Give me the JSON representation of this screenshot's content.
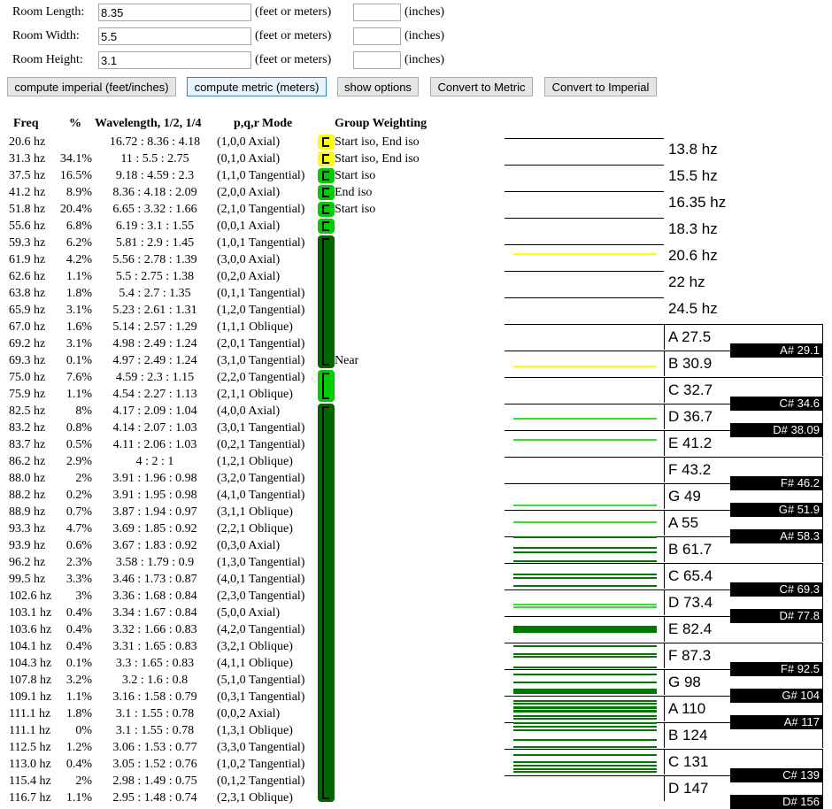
{
  "form": {
    "rows": [
      {
        "label": "Room Length:",
        "value": "8.35",
        "unit": "(feet or meters)",
        "inches_unit": "(inches)"
      },
      {
        "label": "Room Width:",
        "value": "5.5",
        "unit": "(feet or meters)",
        "inches_unit": "(inches)"
      },
      {
        "label": "Room Height:",
        "value": "3.1",
        "unit": "(feet or meters)",
        "inches_unit": "(inches)"
      }
    ],
    "buttons": {
      "imperial": "compute imperial (feet/inches)",
      "metric": "compute metric (meters)",
      "options": "show options",
      "to_metric": "Convert to Metric",
      "to_imperial": "Convert to Imperial"
    }
  },
  "table": {
    "headers": {
      "freq": "Freq",
      "pct": "%",
      "wave": "Wavelength, 1/2, 1/4",
      "mode": "p,q,r Mode",
      "group": "Group Weighting"
    },
    "rows": [
      {
        "freq": "20.6 hz",
        "pct": "",
        "wave": "16.72 : 8.36 : 4.18",
        "mode": "(1,0,0 Axial)",
        "note": "Start iso, End iso"
      },
      {
        "freq": "31.3 hz",
        "pct": "34.1%",
        "wave": "11 : 5.5 : 2.75",
        "mode": "(0,1,0 Axial)",
        "note": "Start iso, End iso"
      },
      {
        "freq": "37.5 hz",
        "pct": "16.5%",
        "wave": "9.18 : 4.59 : 2.3",
        "mode": "(1,1,0 Tangential)",
        "note": "Start iso"
      },
      {
        "freq": "41.2 hz",
        "pct": "8.9%",
        "wave": "8.36 : 4.18 : 2.09",
        "mode": "(2,0,0 Axial)",
        "note": "End iso"
      },
      {
        "freq": "51.8 hz",
        "pct": "20.4%",
        "wave": "6.65 : 3.32 : 1.66",
        "mode": "(2,1,0 Tangential)",
        "note": "Start iso"
      },
      {
        "freq": "55.6 hz",
        "pct": "6.8%",
        "wave": "6.19 : 3.1 : 1.55",
        "mode": "(0,0,1 Axial)",
        "note": ""
      },
      {
        "freq": "59.3 hz",
        "pct": "6.2%",
        "wave": "5.81 : 2.9 : 1.45",
        "mode": "(1,0,1 Tangential)",
        "note": ""
      },
      {
        "freq": "61.9 hz",
        "pct": "4.2%",
        "wave": "5.56 : 2.78 : 1.39",
        "mode": "(3,0,0 Axial)",
        "note": ""
      },
      {
        "freq": "62.6 hz",
        "pct": "1.1%",
        "wave": "5.5 : 2.75 : 1.38",
        "mode": "(0,2,0 Axial)",
        "note": ""
      },
      {
        "freq": "63.8 hz",
        "pct": "1.8%",
        "wave": "5.4 : 2.7 : 1.35",
        "mode": "(0,1,1 Tangential)",
        "note": ""
      },
      {
        "freq": "65.9 hz",
        "pct": "3.1%",
        "wave": "5.23 : 2.61 : 1.31",
        "mode": "(1,2,0 Tangential)",
        "note": ""
      },
      {
        "freq": "67.0 hz",
        "pct": "1.6%",
        "wave": "5.14 : 2.57 : 1.29",
        "mode": "(1,1,1 Oblique)",
        "note": ""
      },
      {
        "freq": "69.2 hz",
        "pct": "3.1%",
        "wave": "4.98 : 2.49 : 1.24",
        "mode": "(2,0,1 Tangential)",
        "note": ""
      },
      {
        "freq": "69.3 hz",
        "pct": "0.1%",
        "wave": "4.97 : 2.49 : 1.24",
        "mode": "(3,1,0 Tangential)",
        "note": "Near"
      },
      {
        "freq": "75.0 hz",
        "pct": "7.6%",
        "wave": "4.59 : 2.3 : 1.15",
        "mode": "(2,2,0 Tangential)",
        "note": ""
      },
      {
        "freq": "75.9 hz",
        "pct": "1.1%",
        "wave": "4.54 : 2.27 : 1.13",
        "mode": "(2,1,1 Oblique)",
        "note": ""
      },
      {
        "freq": "82.5 hz",
        "pct": "8%",
        "wave": "4.17 : 2.09 : 1.04",
        "mode": "(4,0,0 Axial)",
        "note": ""
      },
      {
        "freq": "83.2 hz",
        "pct": "0.8%",
        "wave": "4.14 : 2.07 : 1.03",
        "mode": "(3,0,1 Tangential)",
        "note": ""
      },
      {
        "freq": "83.7 hz",
        "pct": "0.5%",
        "wave": "4.11 : 2.06 : 1.03",
        "mode": "(0,2,1 Tangential)",
        "note": ""
      },
      {
        "freq": "86.2 hz",
        "pct": "2.9%",
        "wave": "4 : 2 : 1",
        "mode": "(1,2,1 Oblique)",
        "note": ""
      },
      {
        "freq": "88.0 hz",
        "pct": "2%",
        "wave": "3.91 : 1.96 : 0.98",
        "mode": "(3,2,0 Tangential)",
        "note": ""
      },
      {
        "freq": "88.2 hz",
        "pct": "0.2%",
        "wave": "3.91 : 1.95 : 0.98",
        "mode": "(4,1,0 Tangential)",
        "note": ""
      },
      {
        "freq": "88.9 hz",
        "pct": "0.7%",
        "wave": "3.87 : 1.94 : 0.97",
        "mode": "(3,1,1 Oblique)",
        "note": ""
      },
      {
        "freq": "93.3 hz",
        "pct": "4.7%",
        "wave": "3.69 : 1.85 : 0.92",
        "mode": "(2,2,1 Oblique)",
        "note": ""
      },
      {
        "freq": "93.9 hz",
        "pct": "0.6%",
        "wave": "3.67 : 1.83 : 0.92",
        "mode": "(0,3,0 Axial)",
        "note": ""
      },
      {
        "freq": "96.2 hz",
        "pct": "2.3%",
        "wave": "3.58 : 1.79 : 0.9",
        "mode": "(1,3,0 Tangential)",
        "note": ""
      },
      {
        "freq": "99.5 hz",
        "pct": "3.3%",
        "wave": "3.46 : 1.73 : 0.87",
        "mode": "(4,0,1 Tangential)",
        "note": ""
      },
      {
        "freq": "102.6 hz",
        "pct": "3%",
        "wave": "3.36 : 1.68 : 0.84",
        "mode": "(2,3,0 Tangential)",
        "note": ""
      },
      {
        "freq": "103.1 hz",
        "pct": "0.4%",
        "wave": "3.34 : 1.67 : 0.84",
        "mode": "(5,0,0 Axial)",
        "note": ""
      },
      {
        "freq": "103.6 hz",
        "pct": "0.4%",
        "wave": "3.32 : 1.66 : 0.83",
        "mode": "(4,2,0 Tangential)",
        "note": ""
      },
      {
        "freq": "104.1 hz",
        "pct": "0.4%",
        "wave": "3.31 : 1.65 : 0.83",
        "mode": "(3,2,1 Oblique)",
        "note": ""
      },
      {
        "freq": "104.3 hz",
        "pct": "0.1%",
        "wave": "3.3 : 1.65 : 0.83",
        "mode": "(4,1,1 Oblique)",
        "note": ""
      },
      {
        "freq": "107.8 hz",
        "pct": "3.2%",
        "wave": "3.2 : 1.6 : 0.8",
        "mode": "(5,1,0 Tangential)",
        "note": ""
      },
      {
        "freq": "109.1 hz",
        "pct": "1.1%",
        "wave": "3.16 : 1.58 : 0.79",
        "mode": "(0,3,1 Tangential)",
        "note": ""
      },
      {
        "freq": "111.1 hz",
        "pct": "1.8%",
        "wave": "3.1 : 1.55 : 0.78",
        "mode": "(0,0,2 Axial)",
        "note": ""
      },
      {
        "freq": "111.1 hz",
        "pct": "0%",
        "wave": "3.1 : 1.55 : 0.78",
        "mode": "(1,3,1 Oblique)",
        "note": ""
      },
      {
        "freq": "112.5 hz",
        "pct": "1.2%",
        "wave": "3.06 : 1.53 : 0.77",
        "mode": "(3,3,0 Tangential)",
        "note": ""
      },
      {
        "freq": "113.0 hz",
        "pct": "0.4%",
        "wave": "3.05 : 1.52 : 0.76",
        "mode": "(1,0,2 Tangential)",
        "note": ""
      },
      {
        "freq": "115.4 hz",
        "pct": "2%",
        "wave": "2.98 : 1.49 : 0.75",
        "mode": "(0,1,2 Tangential)",
        "note": ""
      },
      {
        "freq": "116.7 hz",
        "pct": "1.1%",
        "wave": "2.95 : 1.48 : 0.74",
        "mode": "(2,3,1 Oblique)",
        "note": ""
      }
    ],
    "groups": [
      {
        "rows": [
          0,
          0
        ],
        "color": "#ffff00"
      },
      {
        "rows": [
          1,
          1
        ],
        "color": "#ffff00"
      },
      {
        "rows": [
          2,
          2
        ],
        "color": "#00cc00"
      },
      {
        "rows": [
          3,
          3
        ],
        "color": "#00cc00"
      },
      {
        "rows": [
          4,
          4
        ],
        "color": "#00cc00"
      },
      {
        "rows": [
          5,
          5
        ],
        "color": "#00cc00"
      },
      {
        "rows": [
          6,
          13
        ],
        "color": "#006600"
      },
      {
        "rows": [
          14,
          15
        ],
        "color": "#00cc00"
      },
      {
        "rows": [
          16,
          39
        ],
        "color": "#006600"
      }
    ]
  },
  "keyboard": {
    "top_freq_labels": [
      "13.8 hz",
      "15.5 hz",
      "16.35 hz",
      "18.3 hz",
      "20.6 hz",
      "22 hz",
      "24.5 hz"
    ],
    "white_keys": [
      "A 27.5",
      "B 30.9",
      "C 32.7",
      "D 36.7",
      "E 41.2",
      "F 43.2",
      "G 49",
      "A 55",
      "B 61.7",
      "C 65.4",
      "D 73.4",
      "E 82.4",
      "F 87.3",
      "G 98",
      "A 110",
      "B 124",
      "C 131",
      "D 147"
    ],
    "black_keys": [
      {
        "label": "A# 29.1",
        "after": 0
      },
      {
        "label": "C# 34.6",
        "after": 2
      },
      {
        "label": "D# 38.09",
        "after": 3
      },
      {
        "label": "F# 46.2",
        "after": 5
      },
      {
        "label": "G# 51.9",
        "after": 6
      },
      {
        "label": "A# 58.3",
        "after": 7
      },
      {
        "label": "C# 69.3",
        "after": 9
      },
      {
        "label": "D# 77.8",
        "after": 10
      },
      {
        "label": "F# 92.5",
        "after": 12
      },
      {
        "label": "G# 104",
        "after": 13
      },
      {
        "label": "A# 117",
        "after": 14
      },
      {
        "label": "C# 139",
        "after": 16
      },
      {
        "label": "D# 156",
        "after": 17
      }
    ],
    "mode_lines": [
      {
        "freq": 20.6,
        "color": "#ffff00",
        "weight": 2
      },
      {
        "freq": 31.3,
        "color": "#ffff00",
        "weight": 2
      },
      {
        "freq": 37.5,
        "color": "#33dd33",
        "weight": 2
      },
      {
        "freq": 41.2,
        "color": "#33dd33",
        "weight": 2
      },
      {
        "freq": 51.8,
        "color": "#33dd33",
        "weight": 2
      },
      {
        "freq": 55.6,
        "color": "#33dd33",
        "weight": 2
      },
      {
        "freq": 59.3,
        "color": "#007700",
        "weight": 2
      },
      {
        "freq": 61.9,
        "color": "#007700",
        "weight": 2
      },
      {
        "freq": 62.6,
        "color": "#007700",
        "weight": 2
      },
      {
        "freq": 63.8,
        "color": "#007700",
        "weight": 2
      },
      {
        "freq": 65.9,
        "color": "#007700",
        "weight": 2
      },
      {
        "freq": 67.0,
        "color": "#007700",
        "weight": 2
      },
      {
        "freq": 69.2,
        "color": "#007700",
        "weight": 2
      },
      {
        "freq": 69.3,
        "color": "#007700",
        "weight": 2
      },
      {
        "freq": 75.0,
        "color": "#33dd33",
        "weight": 2
      },
      {
        "freq": 75.9,
        "color": "#33dd33",
        "weight": 2
      },
      {
        "freq": 82.5,
        "color": "#007700",
        "weight": 5
      },
      {
        "freq": 83.2,
        "color": "#007700",
        "weight": 4
      },
      {
        "freq": 86.2,
        "color": "#007700",
        "weight": 2
      },
      {
        "freq": 88.0,
        "color": "#007700",
        "weight": 2
      },
      {
        "freq": 88.9,
        "color": "#007700",
        "weight": 2
      },
      {
        "freq": 93.3,
        "color": "#007700",
        "weight": 2
      },
      {
        "freq": 96.2,
        "color": "#007700",
        "weight": 2
      },
      {
        "freq": 99.5,
        "color": "#007700",
        "weight": 2
      },
      {
        "freq": 102.6,
        "color": "#007700",
        "weight": 2
      },
      {
        "freq": 103.1,
        "color": "#007700",
        "weight": 2
      },
      {
        "freq": 103.6,
        "color": "#007700",
        "weight": 2
      },
      {
        "freq": 104.1,
        "color": "#007700",
        "weight": 2
      },
      {
        "freq": 107.8,
        "color": "#007700",
        "weight": 2
      },
      {
        "freq": 109.1,
        "color": "#007700",
        "weight": 2
      },
      {
        "freq": 111.1,
        "color": "#007700",
        "weight": 3
      },
      {
        "freq": 112.5,
        "color": "#007700",
        "weight": 2
      },
      {
        "freq": 113.0,
        "color": "#007700",
        "weight": 2
      },
      {
        "freq": 115.4,
        "color": "#007700",
        "weight": 2
      },
      {
        "freq": 116.7,
        "color": "#007700",
        "weight": 2
      },
      {
        "freq": 119.0,
        "color": "#007700",
        "weight": 2
      },
      {
        "freq": 121.0,
        "color": "#007700",
        "weight": 2
      },
      {
        "freq": 123.0,
        "color": "#007700",
        "weight": 2
      },
      {
        "freq": 126.0,
        "color": "#007700",
        "weight": 2
      },
      {
        "freq": 128.0,
        "color": "#007700",
        "weight": 2
      },
      {
        "freq": 130.0,
        "color": "#007700",
        "weight": 2
      },
      {
        "freq": 133.0,
        "color": "#007700",
        "weight": 2
      },
      {
        "freq": 135.0,
        "color": "#007700",
        "weight": 2
      },
      {
        "freq": 137.0,
        "color": "#007700",
        "weight": 2
      },
      {
        "freq": 139.0,
        "color": "#007700",
        "weight": 2
      }
    ]
  }
}
